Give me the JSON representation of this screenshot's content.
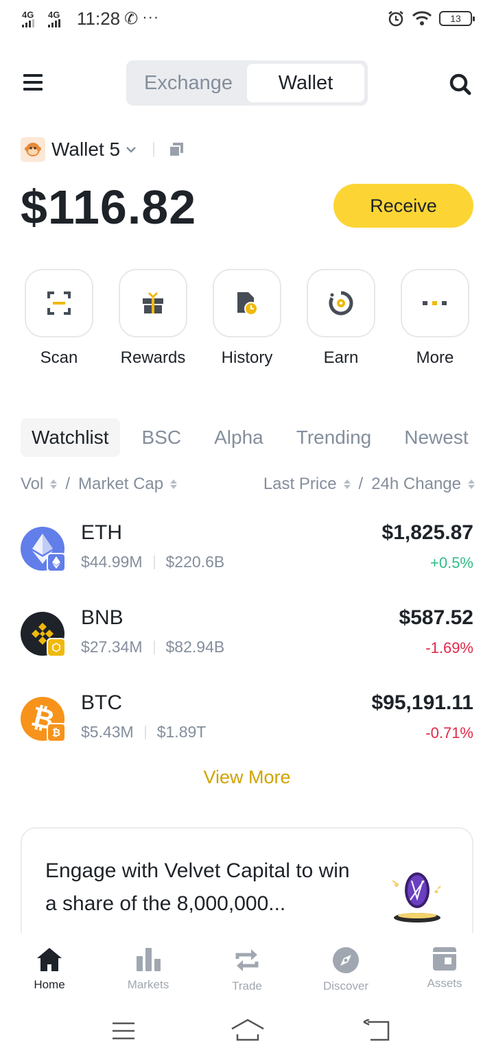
{
  "status_bar": {
    "signal1": "4G",
    "signal2": "4G",
    "time": "11:28",
    "more": "···",
    "battery": "13"
  },
  "header": {
    "segments": [
      "Exchange",
      "Wallet"
    ],
    "active_segment": "Wallet"
  },
  "wallet": {
    "name": "Wallet 5",
    "balance": "$116.82",
    "receive_label": "Receive"
  },
  "actions": [
    {
      "label": "Scan",
      "icon": "scan-icon"
    },
    {
      "label": "Rewards",
      "icon": "gift-icon"
    },
    {
      "label": "History",
      "icon": "history-icon"
    },
    {
      "label": "Earn",
      "icon": "earn-icon"
    },
    {
      "label": "More",
      "icon": "more-icon"
    }
  ],
  "tabs": [
    "Watchlist",
    "BSC",
    "Alpha",
    "Trending",
    "Newest"
  ],
  "active_tab": "Watchlist",
  "sort": {
    "vol": "Vol",
    "slash": "/",
    "market_cap": "Market Cap",
    "last_price": "Last Price",
    "change": "24h Change"
  },
  "coins": [
    {
      "symbol": "ETH",
      "volume": "$44.99M",
      "market_cap": "$220.6B",
      "price": "$1,825.87",
      "change": "+0.5%",
      "direction": "up",
      "color": "#627eea"
    },
    {
      "symbol": "BNB",
      "volume": "$27.34M",
      "market_cap": "$82.94B",
      "price": "$587.52",
      "change": "-1.69%",
      "direction": "down",
      "color": "#1e2329"
    },
    {
      "symbol": "BTC",
      "volume": "$5.43M",
      "market_cap": "$1.89T",
      "price": "$95,191.11",
      "change": "-0.71%",
      "direction": "down",
      "color": "#f7931a"
    }
  ],
  "view_more": "View More",
  "banner": {
    "text": "Engage with Velvet Capital to win a share of the 8,000,000..."
  },
  "bottom_nav": [
    {
      "label": "Home",
      "icon": "home-icon",
      "active": true
    },
    {
      "label": "Markets",
      "icon": "markets-icon",
      "active": false
    },
    {
      "label": "Trade",
      "icon": "trade-icon",
      "active": false
    },
    {
      "label": "Discover",
      "icon": "discover-icon",
      "active": false
    },
    {
      "label": "Assets",
      "icon": "assets-icon",
      "active": false
    }
  ],
  "colors": {
    "accent": "#fcd535",
    "link": "#d0a300",
    "up": "#2ebd85",
    "down": "#e0294a",
    "text": "#1e2329",
    "muted": "#848e9c"
  }
}
